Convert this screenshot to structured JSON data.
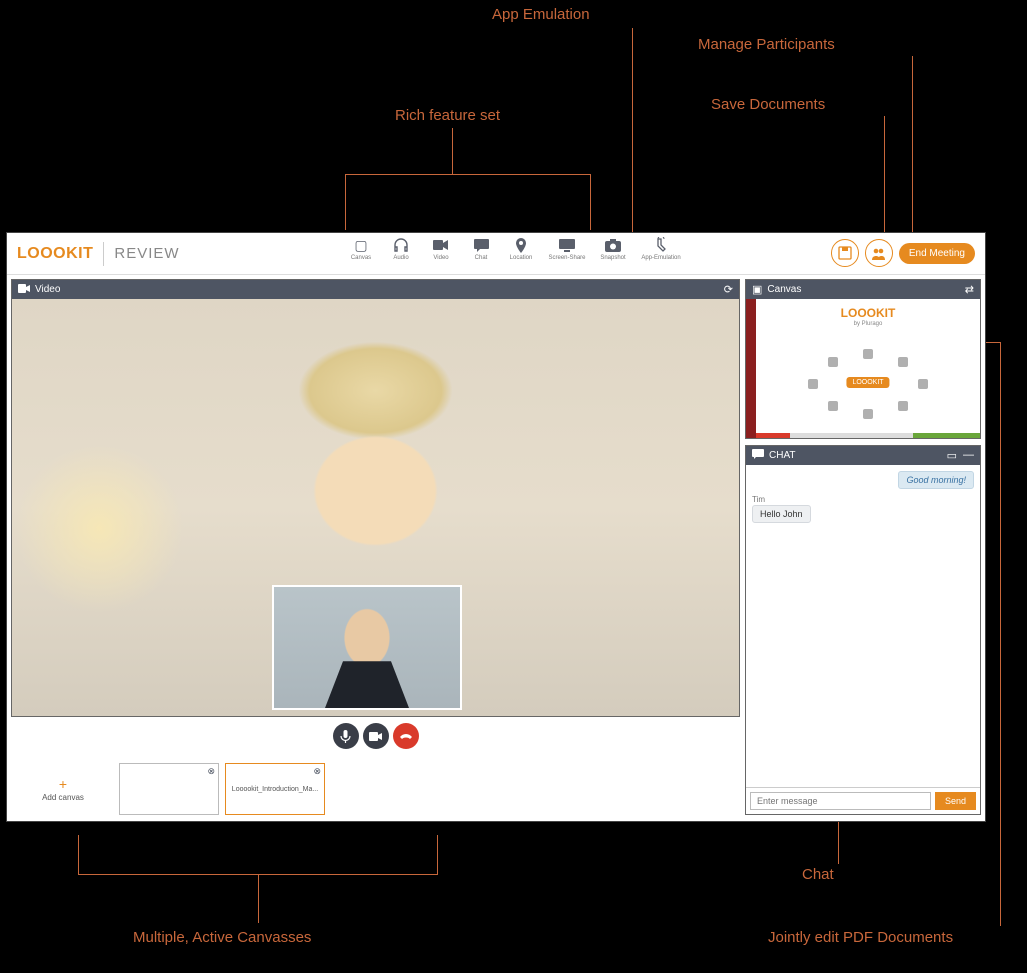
{
  "annotations": {
    "app_emulation": "App Emulation",
    "manage_participants": "Manage Participants",
    "save_documents": "Save Documents",
    "rich_feature_set": "Rich feature set",
    "chat": "Chat",
    "multiple_canvasses": "Multiple, Active Canvasses",
    "jointly_edit": "Jointly edit PDF Documents"
  },
  "app": {
    "logo_brand": "LOOOKIT",
    "page_title": "REVIEW",
    "end_meeting": "End Meeting",
    "toolbar": [
      {
        "label": "Canvas"
      },
      {
        "label": "Audio"
      },
      {
        "label": "Video"
      },
      {
        "label": "Chat"
      },
      {
        "label": "Location"
      },
      {
        "label": "Screen-Share"
      },
      {
        "label": "Snapshot"
      },
      {
        "label": "App-Emulation"
      }
    ]
  },
  "panels": {
    "video_title": "Video",
    "canvas_title": "Canvas",
    "chat_title": "CHAT",
    "canvas_slide_brand": "LOOOKIT",
    "canvas_slide_sub": "by Plurago",
    "canvas_center": "LOOOKIT"
  },
  "chat": {
    "messages": [
      {
        "user": "",
        "text": "Good morning!",
        "side": "right",
        "style": "blue"
      },
      {
        "user": "Tim",
        "text": "Hello John",
        "side": "left",
        "style": ""
      }
    ],
    "placeholder": "Enter message",
    "send": "Send"
  },
  "canvas_strip": {
    "add_label": "Add canvas",
    "items": [
      {
        "label": ""
      },
      {
        "label": "Looookit_Introduction_Ma..."
      }
    ]
  }
}
